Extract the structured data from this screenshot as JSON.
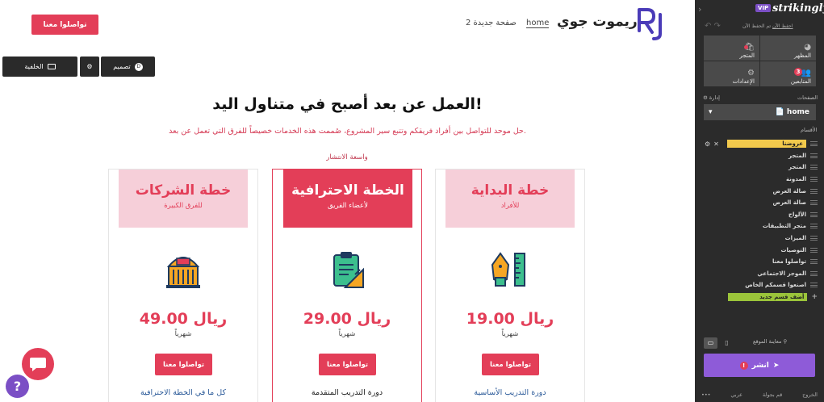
{
  "site": {
    "name": "ريموت جوي",
    "nav": {
      "home": "home",
      "page2": "صفحة جديدة 2"
    },
    "cta_top": "تواصلوا معنا",
    "toolbar": {
      "design": "تصميم",
      "background": "الخلفية",
      "design_badge": "D"
    },
    "headline": "العمل عن بعد أصبح في متناول اليد!",
    "subheadline": "حل موحد للتواصل بين أفراد فريقكم وتتبع سير المشروع، صُممت هذه الخدمات خصيصاً للفرق التي تعمل عن بعد.",
    "badge": "واسعة الانتشار",
    "plans": [
      {
        "title": "خطة الشركات",
        "subtitle": "للفرق الكبيرة",
        "price": "49.00 ريال",
        "period": "شهرياً",
        "button": "تواصلوا معنا",
        "feature": "كل ما في الخطة الاحترافية",
        "icon": "building-icon"
      },
      {
        "title": "الخطة الاحترافية",
        "subtitle": "لأعضاء الفريق",
        "price": "29.00 ريال",
        "period": "شهرياً",
        "button": "تواصلوا معنا",
        "feature": "دورة التدريب المتقدمة",
        "icon": "clipboard-icon"
      },
      {
        "title": "خطة البداية",
        "subtitle": "للأفراد",
        "price": "19.00 ريال",
        "period": "شهرياً",
        "button": "تواصلوا معنا",
        "feature": "دورة التدريب الأساسية",
        "icon": "pen-ruler-icon"
      }
    ],
    "accent_color": "#e33e58"
  },
  "editor": {
    "brand": "strikingly",
    "vip": "VIP",
    "save_status": "تم الحفظ الآن",
    "save_link": "احفظ الآن",
    "tiles": [
      {
        "label": "المظهر",
        "icon": "palette-icon"
      },
      {
        "label": "المتجر",
        "icon": "store-icon"
      },
      {
        "label": "المتابعين",
        "icon": "people-icon",
        "count": "3"
      },
      {
        "label": "الإعدادات",
        "icon": "gear-icon"
      }
    ],
    "pages_label": "الصفحات",
    "manage_label": "إدارة",
    "current_page": "home",
    "sections_label": "الأقسام",
    "sections": [
      "عروضنا",
      "المتجر",
      "المتجر",
      "المدونة",
      "صالة العرض",
      "صالة العرض",
      "الألواح",
      "متجر التطبيقات",
      "الميزات",
      "التوصيات",
      "تواصلوا معنا",
      "الموجز الاجتماعي",
      "اصنعوا قسمكم الخاص"
    ],
    "add_section": "أضف قسم جديد",
    "preview_label": "معاينة الموقع",
    "publish": "انشر",
    "publish_alert": "!",
    "footer": {
      "exit": "الخروج",
      "help": "قم بجولة",
      "lang": "عربي",
      "more": "•••"
    }
  }
}
